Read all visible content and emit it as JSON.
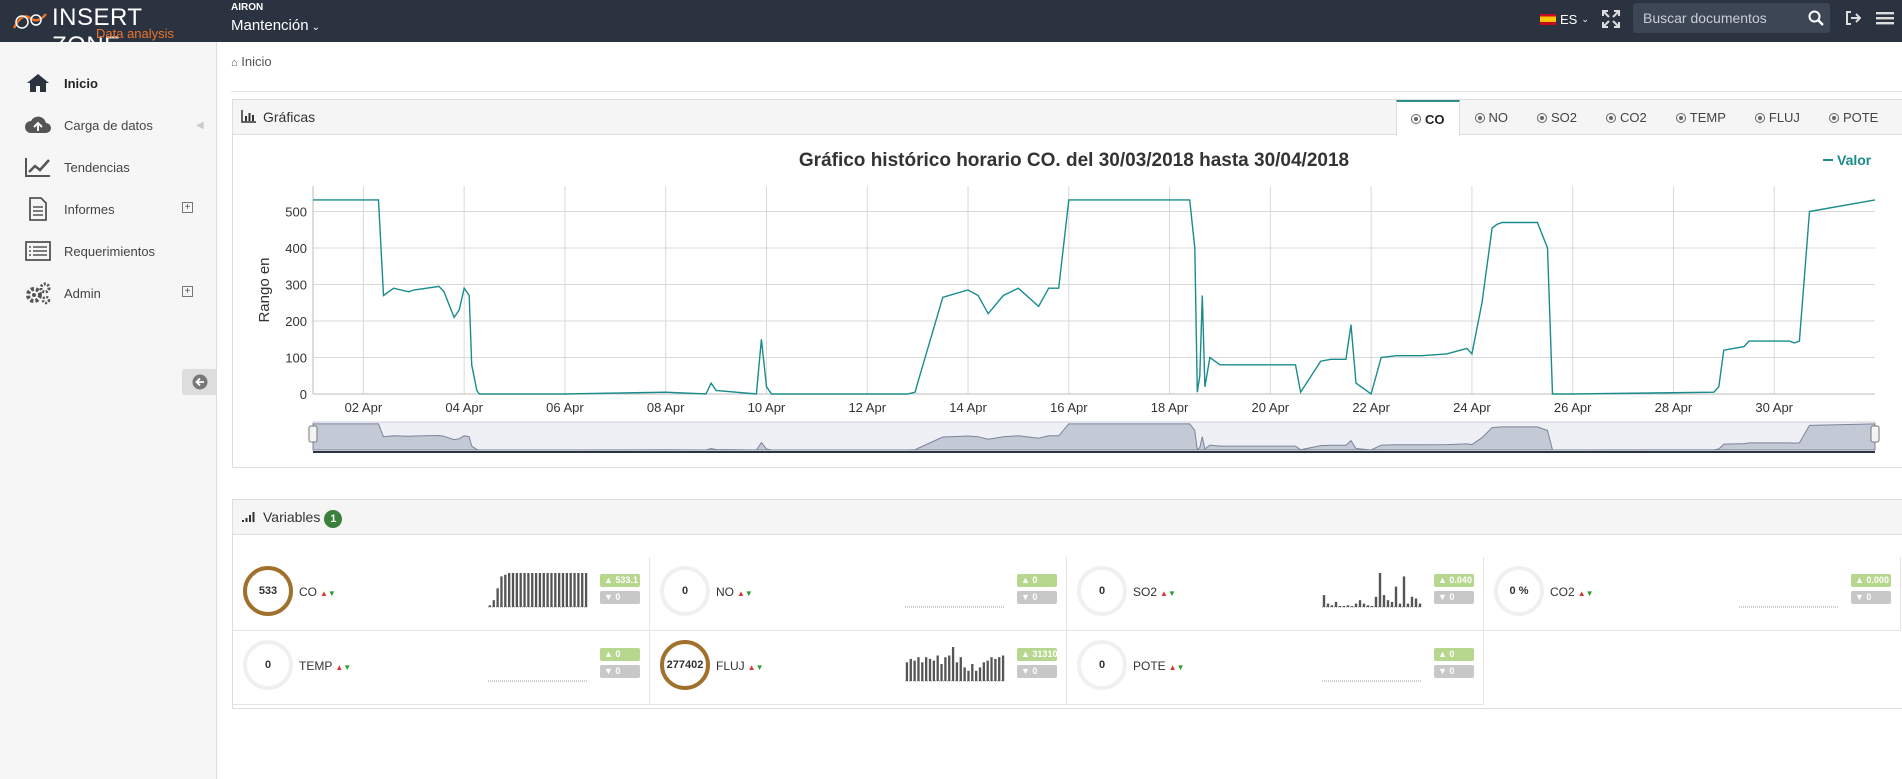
{
  "header": {
    "brand_title": "INSERT ZONE",
    "brand_subtitle": "Data analysis",
    "org_label": "AIRON",
    "org_selected": "Mantención",
    "language": "ES",
    "search_placeholder": "Buscar documentos",
    "icons": [
      "fullscreen-icon",
      "search-icon",
      "sign-out-icon",
      "hamburger-icon"
    ]
  },
  "sidebar": {
    "items": [
      {
        "label": "Inicio",
        "icon": "home-icon",
        "active": true
      },
      {
        "label": "Carga de datos",
        "icon": "cloud-upload-icon"
      },
      {
        "label": "Tendencias",
        "icon": "line-chart-icon"
      },
      {
        "label": "Informes",
        "icon": "document-icon",
        "expandable": true
      },
      {
        "label": "Requerimientos",
        "icon": "list-icon"
      },
      {
        "label": "Admin",
        "icon": "gears-icon",
        "expandable": true
      }
    ]
  },
  "breadcrumb": {
    "label": "Inicio"
  },
  "charts_panel": {
    "title": "Gráficas",
    "tabs": [
      {
        "label": "CO",
        "active": true
      },
      {
        "label": "NO"
      },
      {
        "label": "SO2"
      },
      {
        "label": "CO2"
      },
      {
        "label": "TEMP"
      },
      {
        "label": "FLUJ"
      },
      {
        "label": "POTE"
      }
    ]
  },
  "chart_data": {
    "type": "line",
    "title": "Gráfico histórico horario CO. del 30/03/2018 hasta 30/04/2018",
    "xlabel": "",
    "ylabel": "Rango en",
    "ylim": [
      0,
      570
    ],
    "yticks": [
      0,
      100,
      200,
      300,
      400,
      500
    ],
    "xlim": [
      0,
      31
    ],
    "xticks": [
      {
        "v": 1,
        "label": "02 Apr"
      },
      {
        "v": 3,
        "label": "04 Apr"
      },
      {
        "v": 5,
        "label": "06 Apr"
      },
      {
        "v": 7,
        "label": "08 Apr"
      },
      {
        "v": 9,
        "label": "10 Apr"
      },
      {
        "v": 11,
        "label": "12 Apr"
      },
      {
        "v": 13,
        "label": "14 Apr"
      },
      {
        "v": 15,
        "label": "16 Apr"
      },
      {
        "v": 17,
        "label": "18 Apr"
      },
      {
        "v": 19,
        "label": "20 Apr"
      },
      {
        "v": 21,
        "label": "22 Apr"
      },
      {
        "v": 23,
        "label": "24 Apr"
      },
      {
        "v": 25,
        "label": "26 Apr"
      },
      {
        "v": 27,
        "label": "28 Apr"
      },
      {
        "v": 29,
        "label": "30 Apr"
      }
    ],
    "grid": true,
    "legend": "top-right",
    "series": [
      {
        "name": "Valor",
        "color": "#1a8c8c",
        "x": [
          0,
          1.3,
          1.35,
          1.4,
          1.6,
          1.9,
          2.0,
          2.5,
          2.6,
          2.8,
          2.9,
          3.0,
          3.1,
          3.15,
          3.25,
          3.3,
          3.35,
          5.0,
          7.0,
          7.8,
          7.9,
          8.0,
          8.8,
          8.9,
          9.0,
          9.1,
          11.5,
          11.8,
          11.95,
          12.0,
          12.5,
          13.0,
          13.2,
          13.4,
          13.7,
          14.0,
          14.4,
          14.6,
          14.8,
          15.0,
          17.4,
          17.5,
          17.55,
          17.6,
          17.65,
          17.7,
          17.8,
          18.0,
          18.3,
          19.5,
          19.6,
          20.0,
          20.2,
          20.5,
          20.6,
          20.7,
          21.0,
          21.2,
          21.5,
          22.0,
          22.5,
          22.9,
          23.0,
          23.2,
          23.4,
          23.5,
          23.6,
          24.3,
          24.5,
          24.6,
          25.0,
          27.8,
          27.9,
          28.0,
          28.4,
          28.5,
          29.3,
          29.4,
          29.5,
          29.7,
          31.0
        ],
        "y": [
          532,
          532,
          400,
          270,
          290,
          280,
          285,
          295,
          280,
          210,
          230,
          290,
          270,
          80,
          10,
          0,
          0,
          0,
          5,
          0,
          30,
          10,
          0,
          150,
          20,
          0,
          0,
          0,
          5,
          30,
          265,
          285,
          270,
          220,
          270,
          290,
          240,
          290,
          290,
          532,
          532,
          400,
          5,
          50,
          270,
          20,
          100,
          80,
          80,
          80,
          5,
          90,
          95,
          95,
          190,
          30,
          0,
          100,
          105,
          105,
          110,
          125,
          110,
          250,
          455,
          465,
          470,
          470,
          400,
          0,
          0,
          5,
          20,
          120,
          130,
          145,
          145,
          140,
          145,
          500,
          532
        ]
      }
    ]
  },
  "variables_panel": {
    "title": "Variables",
    "badge": "1",
    "items": [
      {
        "name": "CO",
        "gauge": "533",
        "hot": true,
        "max": "533.1",
        "min": "0",
        "spark": [
          0.05,
          0.2,
          0.55,
          0.9,
          0.95,
          1,
          1,
          1,
          1,
          1,
          1,
          1,
          1,
          1,
          1,
          1,
          1,
          1,
          1,
          1,
          1,
          1,
          1,
          1,
          1,
          1
        ]
      },
      {
        "name": "NO",
        "gauge": "0",
        "hot": false,
        "max": "0",
        "min": "0",
        "spark": []
      },
      {
        "name": "SO2",
        "gauge": "0",
        "hot": false,
        "max": "0.040",
        "min": "0",
        "spark": [
          0.35,
          0.1,
          0.05,
          0.15,
          0,
          0,
          0.05,
          0,
          0.1,
          0.2,
          0.1,
          0.05,
          0,
          0.3,
          1,
          0.35,
          0.2,
          0.15,
          0.6,
          0.1,
          0.9,
          0.1,
          0.3,
          0.25,
          0.1
        ]
      },
      {
        "name": "CO2",
        "gauge": "0 %",
        "hot": false,
        "max": "0.000",
        "min": "0",
        "spark": []
      },
      {
        "name": "TEMP",
        "gauge": "0",
        "hot": false,
        "max": "0",
        "min": "0",
        "spark": []
      },
      {
        "name": "FLUJ",
        "gauge": "277402",
        "hot": true,
        "max": "31310",
        "min": "0",
        "spark": [
          0.55,
          0.65,
          0.6,
          0.7,
          0.55,
          0.7,
          0.65,
          0.6,
          0.75,
          0.5,
          0.7,
          0.75,
          1,
          0.55,
          0.7,
          0.4,
          0.3,
          0.5,
          0.3,
          0.4,
          0.55,
          0.6,
          0.7,
          0.65,
          0.7,
          0.75
        ]
      },
      {
        "name": "POTE",
        "gauge": "0",
        "hot": false,
        "max": "0",
        "min": "0",
        "spark": []
      }
    ]
  }
}
